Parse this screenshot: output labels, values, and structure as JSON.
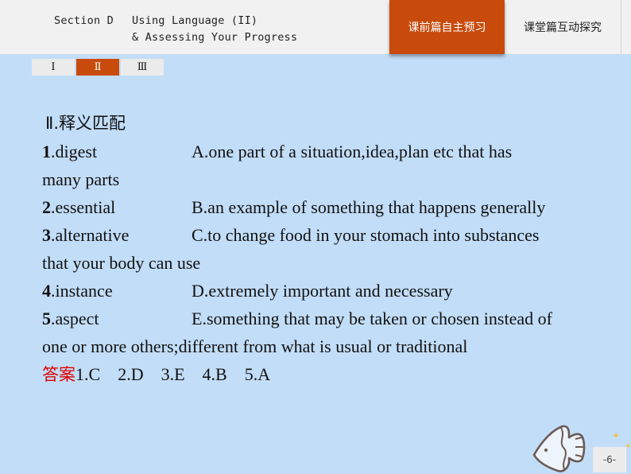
{
  "header": {
    "section": "Section D",
    "title_line1": "Using Language (II)",
    "title_line2": "& Assessing Your Progress"
  },
  "nav_tabs": [
    {
      "label": "课前篇自主预习",
      "active": true
    },
    {
      "label": "课堂篇互动探究",
      "active": false
    }
  ],
  "sub_tabs": [
    {
      "label": "Ⅰ",
      "active": false
    },
    {
      "label": "Ⅱ",
      "active": true
    },
    {
      "label": "Ⅲ",
      "active": false
    }
  ],
  "exercise": {
    "heading": "Ⅱ.释义匹配",
    "items": [
      {
        "num": "1",
        "word": ".digest",
        "definition": "A.one part of a situation,idea,plan etc that has",
        "continuation": "many parts"
      },
      {
        "num": "2",
        "word": ".essential",
        "definition": "B.an example of something that happens generally",
        "continuation": null
      },
      {
        "num": "3",
        "word": ".alternative",
        "definition": "C.to change food in your stomach into substances",
        "continuation": "that your body can use"
      },
      {
        "num": "4",
        "word": ".instance",
        "definition": "D.extremely important and necessary",
        "continuation": null
      },
      {
        "num": "5",
        "word": ".aspect",
        "definition": "E.something that may be taken or chosen instead of",
        "continuation": "one or more others;different from what is usual or traditional"
      }
    ],
    "answer_label": "答案",
    "answers": [
      "1.C",
      "2.D",
      "3.E",
      "4.B",
      "5.A"
    ]
  },
  "page_number": "-6-",
  "colors": {
    "accent": "#c84b0c",
    "background": "#c2ddf8",
    "answer_label": "#e00000"
  }
}
